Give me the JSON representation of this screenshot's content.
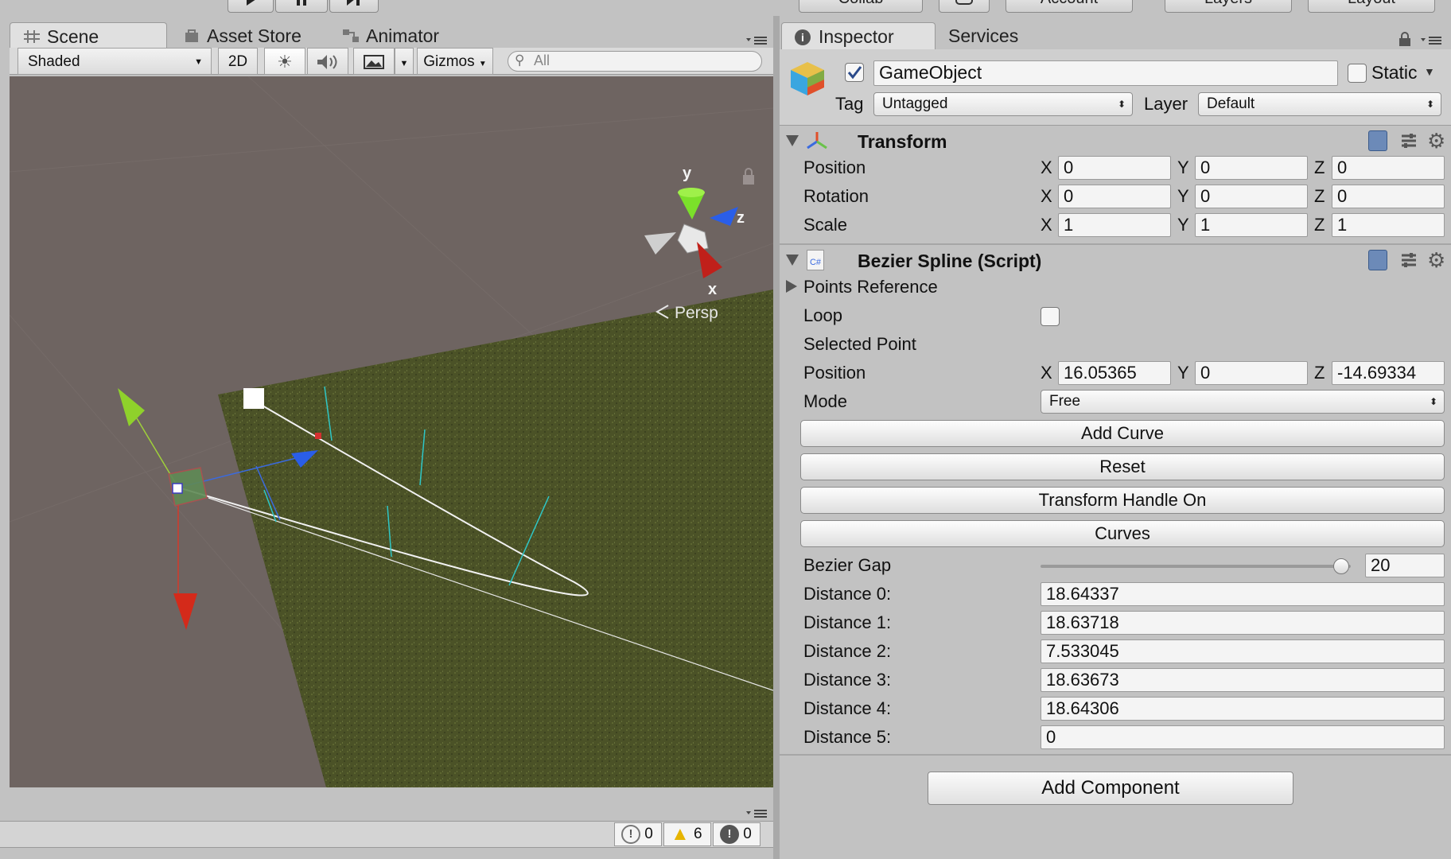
{
  "toolbar": {
    "collab_label": "Collab",
    "account_label": "Account",
    "layers_label": "Layers",
    "layout_label": "Layout"
  },
  "scene_panel": {
    "tabs": [
      {
        "label": "Scene"
      },
      {
        "label": "Asset Store"
      },
      {
        "label": "Animator"
      }
    ],
    "shading_mode": "Shaded",
    "mode_2d": "2D",
    "gizmos_label": "Gizmos",
    "search_placeholder": "All",
    "gizmo_axes": {
      "y": "y",
      "z": "z",
      "x": "x"
    },
    "projection_label": "Persp"
  },
  "console_bar": {
    "info_count": "0",
    "warning_count": "6",
    "error_count": "0"
  },
  "inspector": {
    "tabs": [
      {
        "label": "Inspector"
      },
      {
        "label": "Services"
      }
    ],
    "object_name": "GameObject",
    "static_label": "Static",
    "tag_label": "Tag",
    "tag_value": "Untagged",
    "layer_label": "Layer",
    "layer_value": "Default",
    "transform": {
      "title": "Transform",
      "rows": [
        {
          "label": "Position",
          "x": "0",
          "y": "0",
          "z": "0"
        },
        {
          "label": "Rotation",
          "x": "0",
          "y": "0",
          "z": "0"
        },
        {
          "label": "Scale",
          "x": "1",
          "y": "1",
          "z": "1"
        }
      ]
    },
    "axis_labels": {
      "x": "X",
      "y": "Y",
      "z": "Z"
    },
    "bezier": {
      "title": "Bezier Spline (Script)",
      "points_reference_label": "Points Reference",
      "loop_label": "Loop",
      "selected_point_label": "Selected Point",
      "position_label": "Position",
      "position": {
        "x": "16.05365",
        "y": "0",
        "z": "-14.69334"
      },
      "mode_label": "Mode",
      "mode_value": "Free",
      "buttons": {
        "add_curve": "Add Curve",
        "reset": "Reset",
        "transform_handle": "Transform Handle On",
        "curves": "Curves"
      },
      "bezier_gap_label": "Bezier Gap",
      "bezier_gap_value": "20",
      "bezier_gap_fraction": 0.97,
      "distances": [
        {
          "label": "Distance 0:",
          "value": "18.64337"
        },
        {
          "label": "Distance 1:",
          "value": "18.63718"
        },
        {
          "label": "Distance 2:",
          "value": "7.533045"
        },
        {
          "label": "Distance 3:",
          "value": "18.63673"
        },
        {
          "label": "Distance 4:",
          "value": "18.64306"
        },
        {
          "label": "Distance 5:",
          "value": "0"
        }
      ]
    },
    "add_component_label": "Add Component"
  },
  "colors": {
    "panel_bg": "#c2c2c2",
    "scene_ground": "#6e6461",
    "grass": "#4b5227",
    "axis_x": "#d42a1a",
    "axis_y": "#8fd12b",
    "axis_z": "#2a5ee8"
  }
}
